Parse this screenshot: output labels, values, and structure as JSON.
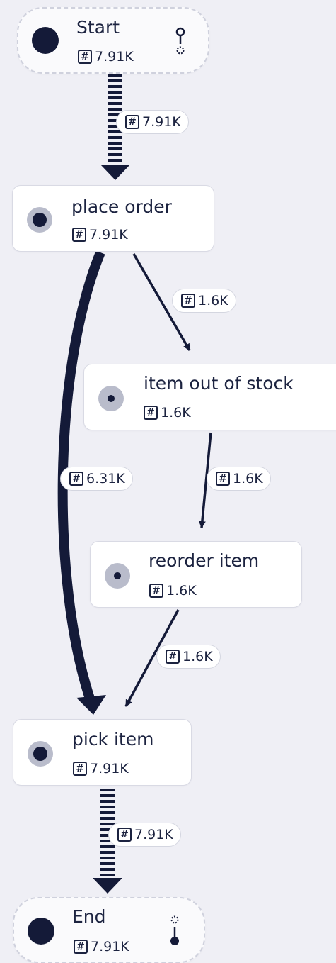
{
  "count_icon": "hash-icon",
  "colors": {
    "edge": "#141a38",
    "background": "#efeff5",
    "node_fill": "#ffffff"
  },
  "nodes": [
    {
      "id": "start",
      "title": "Start",
      "count": "7.91K",
      "kind": "terminal",
      "icon": "start-terminal-icon"
    },
    {
      "id": "place-order",
      "title": "place order",
      "count": "7.91K",
      "kind": "activity"
    },
    {
      "id": "item-out-of-stock",
      "title": "item out of stock",
      "count": "1.6K",
      "kind": "activity"
    },
    {
      "id": "reorder-item",
      "title": "reorder item",
      "count": "1.6K",
      "kind": "activity"
    },
    {
      "id": "pick-item",
      "title": "pick item",
      "count": "7.91K",
      "kind": "activity"
    },
    {
      "id": "end",
      "title": "End",
      "count": "7.91K",
      "kind": "terminal",
      "icon": "end-terminal-icon"
    }
  ],
  "edges": [
    {
      "from": "start",
      "to": "place-order",
      "count": "7.91K",
      "style": "dashed-thick"
    },
    {
      "from": "place-order",
      "to": "item-out-of-stock",
      "count": "1.6K",
      "style": "thin"
    },
    {
      "from": "place-order",
      "to": "pick-item",
      "count": "6.31K",
      "style": "thick-curve"
    },
    {
      "from": "item-out-of-stock",
      "to": "reorder-item",
      "count": "1.6K",
      "style": "thin"
    },
    {
      "from": "reorder-item",
      "to": "pick-item",
      "count": "1.6K",
      "style": "thin"
    },
    {
      "from": "pick-item",
      "to": "end",
      "count": "7.91K",
      "style": "dashed-thick"
    }
  ]
}
